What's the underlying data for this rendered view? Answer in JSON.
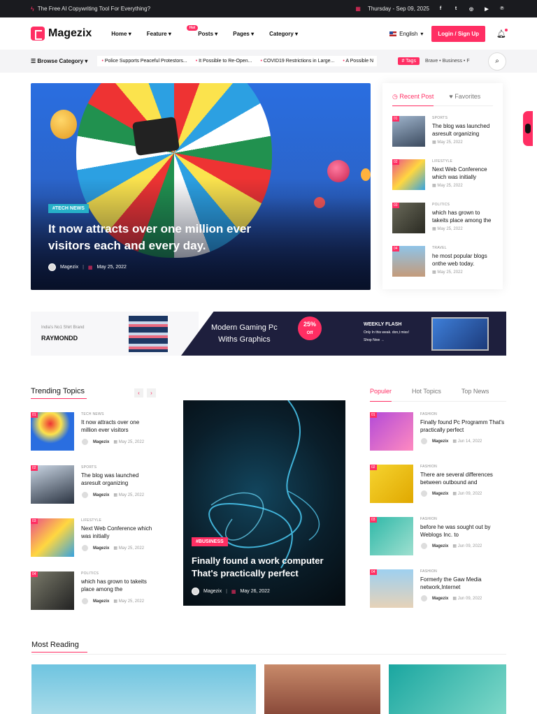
{
  "topbar": {
    "tagline": "The Free AI Copywriting Tool For Everything?",
    "date": "Thursday - Sep 09, 2025",
    "social": [
      "f",
      "t",
      "ig",
      "yt",
      "p"
    ]
  },
  "header": {
    "logo": "Magezix",
    "nav": [
      "Home",
      "Feature",
      "Posts",
      "Pages",
      "Category"
    ],
    "hot_badge": "Hot",
    "language": "English",
    "login": "Login / Sign Up"
  },
  "subbar": {
    "browse": "Browse Category",
    "ticker": [
      "Police Supports Peaceful Protestors...",
      "It Possible to Re-Open...",
      "COVID19 Restrictions in Large...",
      "A Possible N"
    ],
    "tags_label": "# Tags",
    "tags": "Brave • Business • F"
  },
  "hero": {
    "category": "#TECH NEWS",
    "title": "It now attracts over one million ever visitors each and every day.",
    "author": "Magezix",
    "date": "May 25, 2022"
  },
  "sidebar": {
    "tabs": [
      "Recent Post",
      "Favorites"
    ],
    "items": [
      {
        "num": "01",
        "cat": "SPORTS",
        "title": "The blog was launched asresult organizing",
        "date": "May 25, 2022"
      },
      {
        "num": "02",
        "cat": "LIFESTYLE",
        "title": "Next Web Conference which was initially",
        "date": "May 25, 2022"
      },
      {
        "num": "03",
        "cat": "POLITICS",
        "title": "which has grown to takeits place among the",
        "date": "May 25, 2022"
      },
      {
        "num": "04",
        "cat": "TRAVEL",
        "title": "he most popular blogs onthe web today.",
        "date": "May 25, 2022"
      }
    ]
  },
  "ad": {
    "brand_small": "India's No1 Shirt Brand",
    "brand": "RAYMONDD",
    "headline1": "Modern Gaming Pc",
    "headline2": "Withs Graphics",
    "pct": "25%",
    "off": "Off",
    "flash": "WEEKLY FLASH",
    "flash_sub": "Only In this weak. don,t miss!",
    "shop": "Shop Now →"
  },
  "trending": {
    "title": "Trending Topics",
    "items": [
      {
        "num": "01",
        "cat": "TECH NEWS",
        "title": "It now attracts over one million ever visitors",
        "author": "Magezix",
        "date": "May 25, 2022"
      },
      {
        "num": "02",
        "cat": "SPORTS",
        "title": "The blog was launched asresult organizing",
        "author": "Magezix",
        "date": "May 25, 2022"
      },
      {
        "num": "03",
        "cat": "LIFESTYLE",
        "title": "Next Web Conference which was initially",
        "author": "Magezix",
        "date": "May 25, 2022"
      },
      {
        "num": "04",
        "cat": "POLITICS",
        "title": "which has grown to takeits place among the",
        "author": "Magezix",
        "date": "May 25, 2022"
      }
    ]
  },
  "featured": {
    "category": "#BUSINESS",
    "title": "Finally found a work computer That's practically perfect",
    "author": "Magezix",
    "date": "May 26, 2022"
  },
  "popular": {
    "tabs": [
      "Populer",
      "Hot Topics",
      "Top News"
    ],
    "items": [
      {
        "num": "01",
        "cat": "FASHION",
        "title": "Finally found Pc Programm That's practically perfect",
        "author": "Magezix",
        "date": "Jun 14, 2022"
      },
      {
        "num": "02",
        "cat": "FASHION",
        "title": "There are several differences between outbound and",
        "author": "Magezix",
        "date": "Jun 09, 2022"
      },
      {
        "num": "03",
        "cat": "FASHION",
        "title": "before he was sought out by Weblogs Inc. to",
        "author": "Magezix",
        "date": "Jun 09, 2022"
      },
      {
        "num": "04",
        "cat": "FASHION",
        "title": "Formerly the Gaw Media network,Internet",
        "author": "Magezix",
        "date": "Jun 09, 2022"
      }
    ]
  },
  "most_reading": {
    "title": "Most Reading"
  },
  "colors": {
    "accent": "#ff2e63",
    "dark": "#1a1b1f"
  }
}
